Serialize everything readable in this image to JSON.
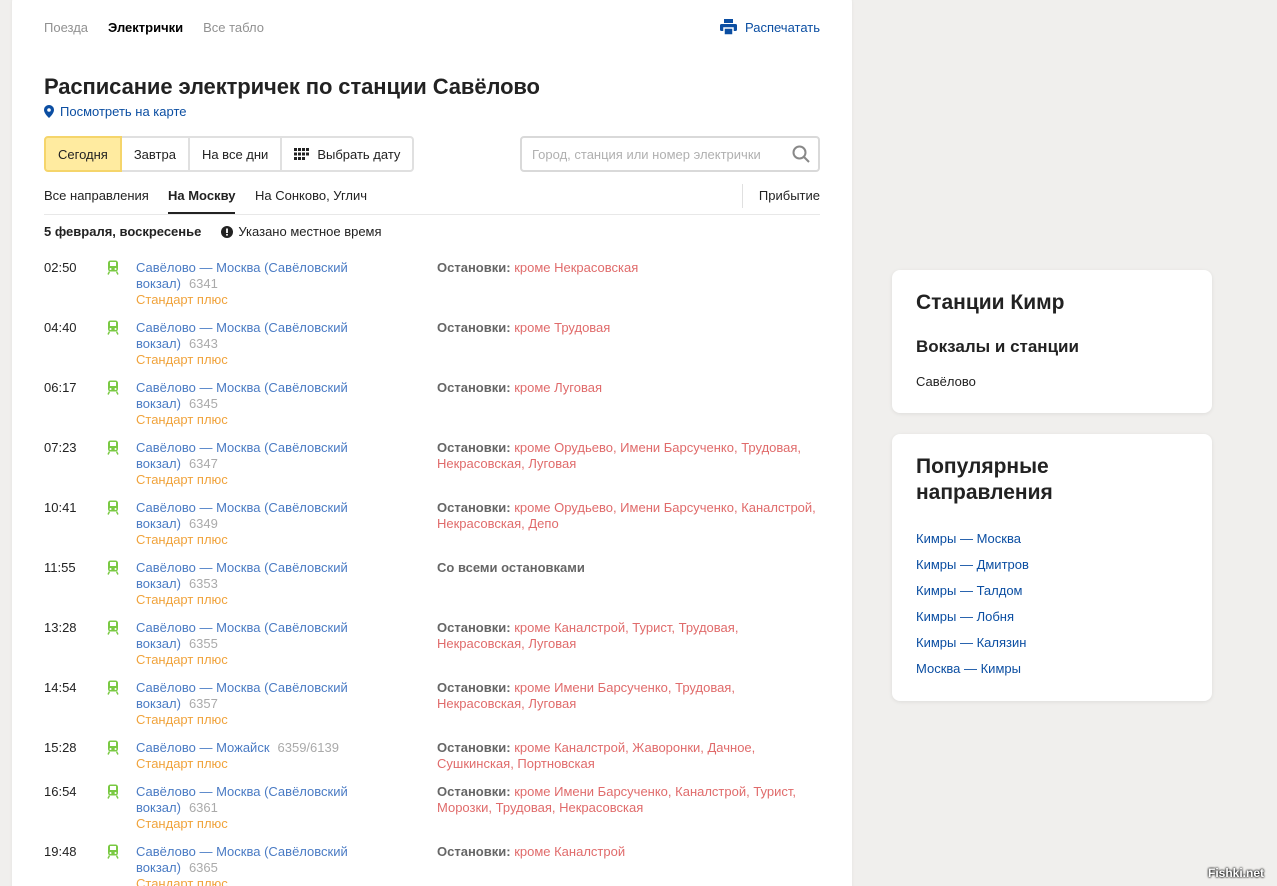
{
  "nav": {
    "items": [
      "Поезда",
      "Электрички",
      "Все табло"
    ],
    "active_index": 1,
    "print_label": "Распечатать"
  },
  "page": {
    "title": "Расписание электричек по станции Савёлово",
    "map_link": "Посмотреть на карте"
  },
  "date_tabs": {
    "today": "Сегодня",
    "tomorrow": "Завтра",
    "all_days": "На все дни",
    "pick_date": "Выбрать дату"
  },
  "search": {
    "placeholder": "Город, станция или номер электрички",
    "value": ""
  },
  "direction_tabs": {
    "all": "Все направления",
    "moscow": "На Москву",
    "sonkovo": "На Сонково, Углич",
    "arrival": "Прибытие"
  },
  "date_info": {
    "date": "5 февраля, воскресенье",
    "note": "Указано местное время"
  },
  "trains": [
    {
      "time": "02:50",
      "route": "Савёлово — Москва (Савёловский вокзал)",
      "number": "6341",
      "class": "Стандарт плюс",
      "stops_label": "Остановки:",
      "stops": "кроме Некрасовская"
    },
    {
      "time": "04:40",
      "route": "Савёлово — Москва (Савёловский вокзал)",
      "number": "6343",
      "class": "Стандарт плюс",
      "stops_label": "Остановки:",
      "stops": "кроме Трудовая"
    },
    {
      "time": "06:17",
      "route": "Савёлово — Москва (Савёловский вокзал)",
      "number": "6345",
      "class": "Стандарт плюс",
      "stops_label": "Остановки:",
      "stops": "кроме Луговая"
    },
    {
      "time": "07:23",
      "route": "Савёлово — Москва (Савёловский вокзал)",
      "number": "6347",
      "class": "Стандарт плюс",
      "stops_label": "Остановки:",
      "stops": "кроме Орудьево, Имени Барсученко, Трудовая, Некрасовская, Луговая"
    },
    {
      "time": "10:41",
      "route": "Савёлово — Москва (Савёловский вокзал)",
      "number": "6349",
      "class": "Стандарт плюс",
      "stops_label": "Остановки:",
      "stops": "кроме Орудьево, Имени Барсученко, Каналстрой, Некрасовская, Депо"
    },
    {
      "time": "11:55",
      "route": "Савёлово — Москва (Савёловский вокзал)",
      "number": "6353",
      "class": "Стандарт плюс",
      "stops_label": "Со всеми остановками",
      "stops": ""
    },
    {
      "time": "13:28",
      "route": "Савёлово — Москва (Савёловский вокзал)",
      "number": "6355",
      "class": "Стандарт плюс",
      "stops_label": "Остановки:",
      "stops": "кроме Каналстрой, Турист, Трудовая, Некрасовская, Луговая"
    },
    {
      "time": "14:54",
      "route": "Савёлово — Москва (Савёловский вокзал)",
      "number": "6357",
      "class": "Стандарт плюс",
      "stops_label": "Остановки:",
      "stops": "кроме Имени Барсученко, Трудовая, Некрасовская, Луговая"
    },
    {
      "time": "15:28",
      "route": "Савёлово — Можайск",
      "number": "6359/6139",
      "class": "Стандарт плюс",
      "stops_label": "Остановки:",
      "stops": "кроме Каналстрой, Жаворонки, Дачное, Сушкинская, Портновская"
    },
    {
      "time": "16:54",
      "route": "Савёлово — Москва (Савёловский вокзал)",
      "number": "6361",
      "class": "Стандарт плюс",
      "stops_label": "Остановки:",
      "stops": "кроме Имени Барсученко, Каналстрой, Турист, Морозки, Трудовая, Некрасовская"
    },
    {
      "time": "19:48",
      "route": "Савёлово — Москва (Савёловский вокзал)",
      "number": "6365",
      "class": "Стандарт плюс",
      "stops_label": "Остановки:",
      "stops": "кроме Каналстрой"
    }
  ],
  "sidebar": {
    "stations_card": {
      "title": "Станции Кимр",
      "subtitle": "Вокзалы и станции",
      "station": "Савёлово"
    },
    "popular_card": {
      "title": "Популярные направления",
      "links": [
        "Кимры — Москва",
        "Кимры — Дмитров",
        "Кимры — Талдом",
        "Кимры — Лобня",
        "Кимры — Калязин",
        "Москва — Кимры"
      ]
    }
  },
  "watermark": "Fishki.net",
  "colors": {
    "link": "#0b4ea2",
    "route": "#4a7bc4",
    "stops": "#e06b6b",
    "train_class": "#f0a33c",
    "train_icon": "#7ac943",
    "active_tab": "#ffeba0"
  }
}
